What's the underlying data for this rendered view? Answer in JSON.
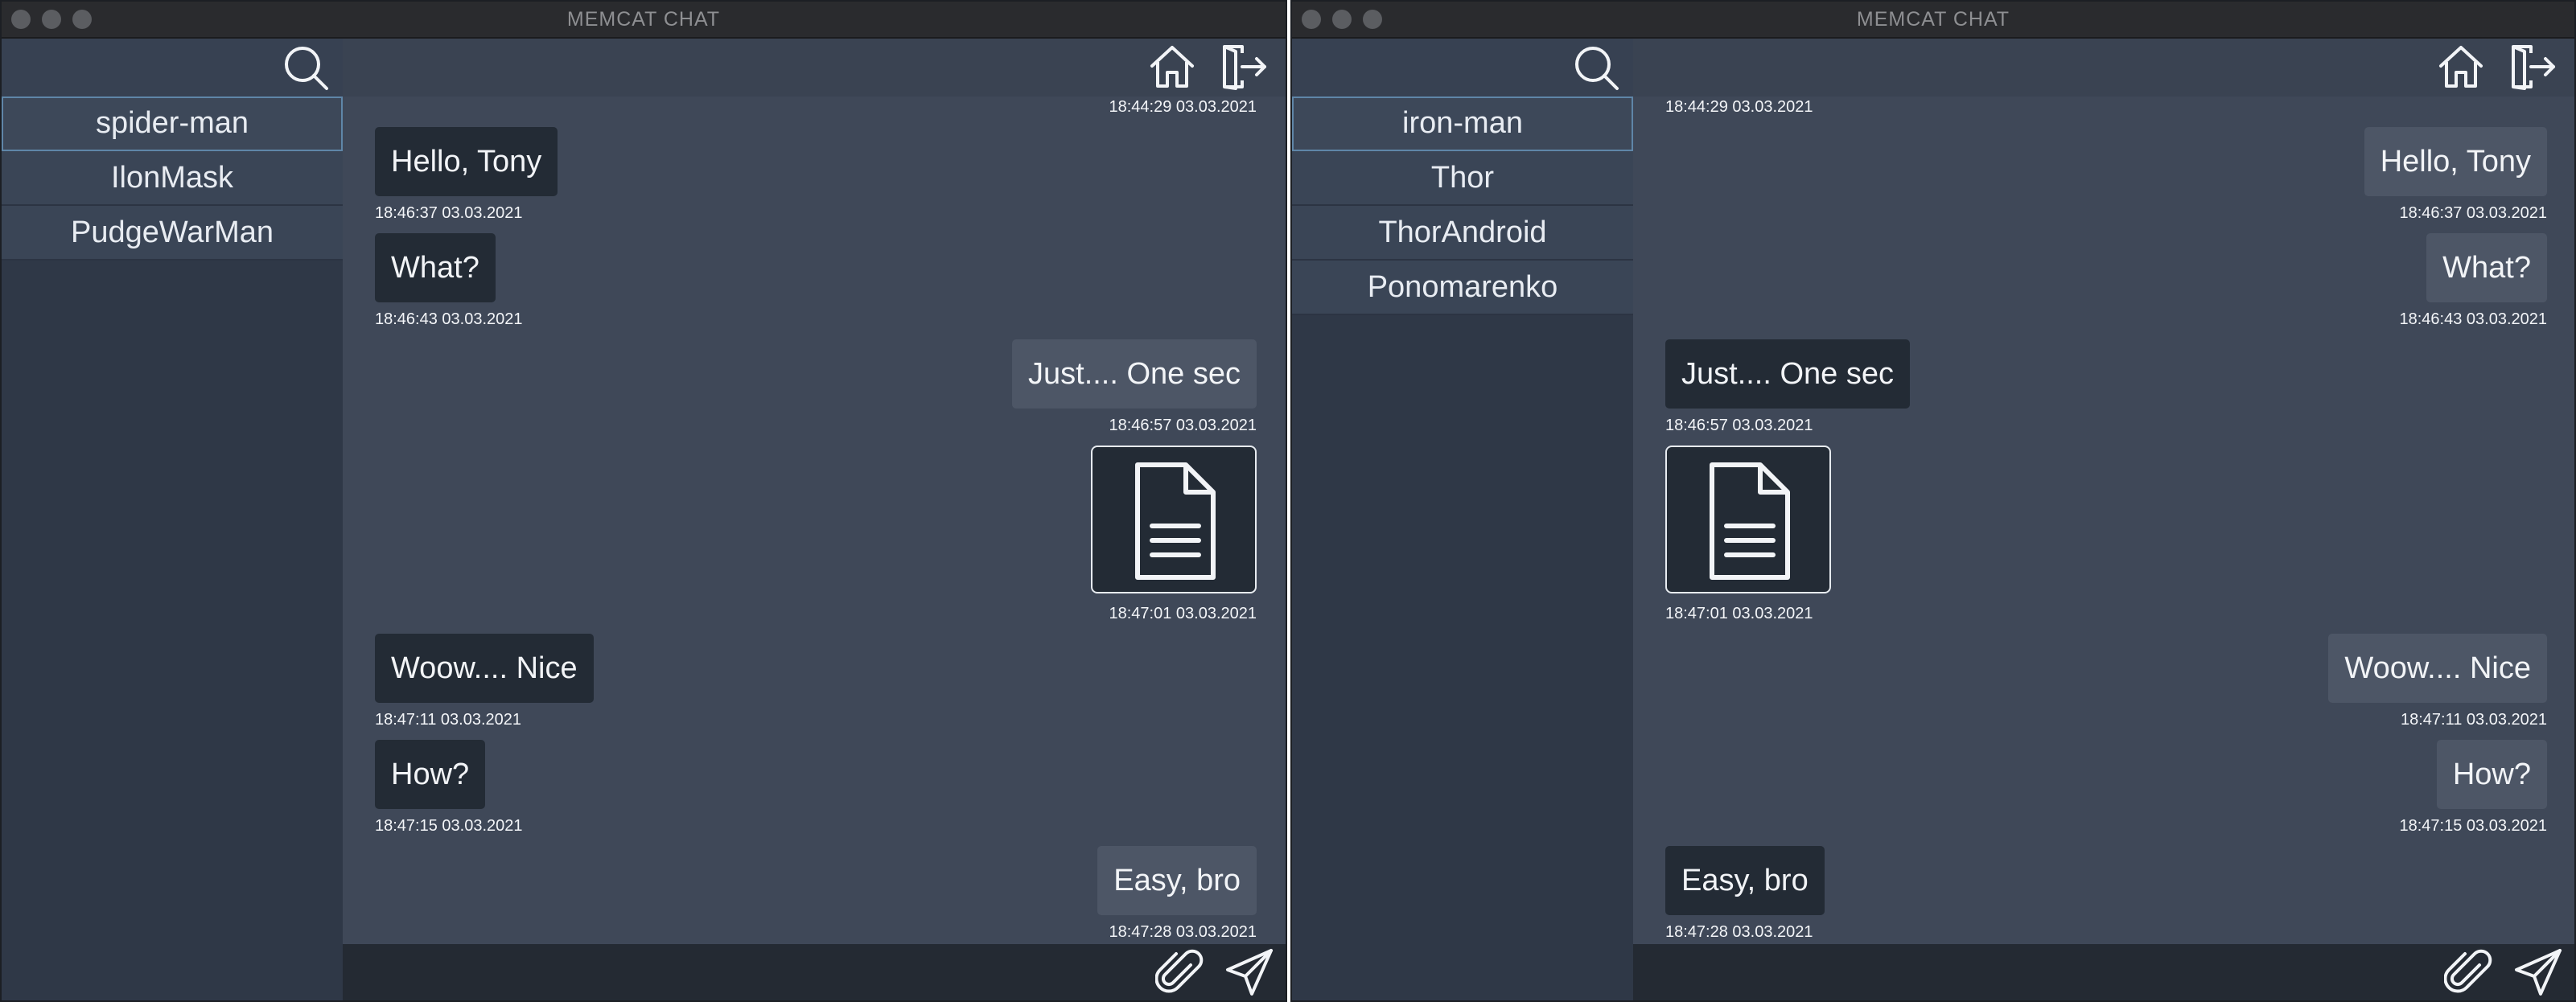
{
  "windows": {
    "left": {
      "title": "MEMCAT CHAT",
      "contacts": [
        {
          "name": "spider-man",
          "selected": true
        },
        {
          "name": "IlonMask",
          "selected": false
        },
        {
          "name": "PudgeWarMan",
          "selected": false
        }
      ],
      "top_time": "18:44:29 03.03.2021",
      "messages": [
        {
          "type": "text",
          "text": "Hello, Tony",
          "side": "left",
          "time": "18:46:37 03.03.2021"
        },
        {
          "type": "text",
          "text": "What?",
          "side": "left",
          "time": "18:46:43 03.03.2021"
        },
        {
          "type": "text",
          "text": "Just.... One sec",
          "side": "right",
          "time": "18:46:57 03.03.2021"
        },
        {
          "type": "file",
          "icon": "document-icon",
          "side": "right",
          "time": "18:47:01 03.03.2021"
        },
        {
          "type": "text",
          "text": "Woow.... Nice",
          "side": "left",
          "time": "18:47:11 03.03.2021"
        },
        {
          "type": "text",
          "text": "How?",
          "side": "left",
          "time": "18:47:15 03.03.2021"
        },
        {
          "type": "text",
          "text": "Easy, bro",
          "side": "right",
          "time": "18:47:28 03.03.2021"
        }
      ]
    },
    "right": {
      "title": "MEMCAT CHAT",
      "contacts": [
        {
          "name": "iron-man",
          "selected": true
        },
        {
          "name": "Thor",
          "selected": false
        },
        {
          "name": "ThorAndroid",
          "selected": false
        },
        {
          "name": "Ponomarenko",
          "selected": false
        }
      ],
      "top_time": "18:44:29 03.03.2021",
      "messages": [
        {
          "type": "text",
          "text": "Hello, Tony",
          "side": "right",
          "time": "18:46:37 03.03.2021"
        },
        {
          "type": "text",
          "text": "What?",
          "side": "right",
          "time": "18:46:43 03.03.2021"
        },
        {
          "type": "text",
          "text": "Just.... One sec",
          "side": "left",
          "time": "18:46:57 03.03.2021"
        },
        {
          "type": "file",
          "icon": "document-icon",
          "side": "left",
          "time": "18:47:01 03.03.2021"
        },
        {
          "type": "text",
          "text": "Woow.... Nice",
          "side": "right",
          "time": "18:47:11 03.03.2021"
        },
        {
          "type": "text",
          "text": "How?",
          "side": "right",
          "time": "18:47:15 03.03.2021"
        },
        {
          "type": "text",
          "text": "Easy, bro",
          "side": "left",
          "time": "18:47:28 03.03.2021"
        }
      ]
    }
  },
  "icons": {
    "search": "search-icon",
    "home": "home-icon",
    "logout": "logout-icon",
    "attach": "paperclip-icon",
    "send": "send-icon",
    "file": "document-icon"
  },
  "colors": {
    "window_bg": "#3f4858",
    "sidebar_bg": "#2f3847",
    "bubble_dark": "#232b35",
    "bubble_light": "#4d5666",
    "selected_outline": "#5f86a8"
  }
}
